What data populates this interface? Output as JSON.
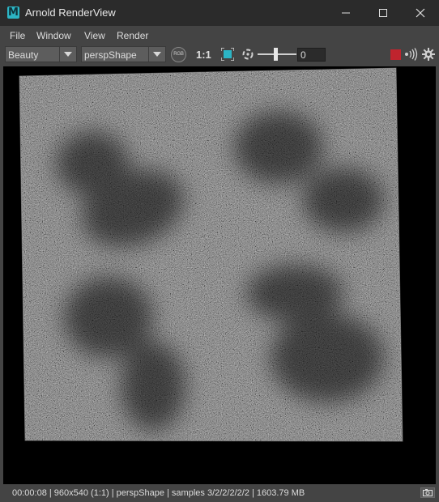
{
  "window": {
    "title": "Arnold RenderView",
    "app_icon_letter": "M"
  },
  "menu": {
    "items": [
      "File",
      "Window",
      "View",
      "Render"
    ]
  },
  "toolbar": {
    "aov": "Beauty",
    "camera": "perspShape",
    "rgb_label": "RGB",
    "ratio": "1:1",
    "exposure": "0",
    "colors": {
      "stop": "#c0242e",
      "accent": "#2cb5c5"
    }
  },
  "status": {
    "text": "00:00:08 | 960x540 (1:1) | perspShape  | samples 3/2/2/2/2/2 | 1603.79 MB"
  }
}
